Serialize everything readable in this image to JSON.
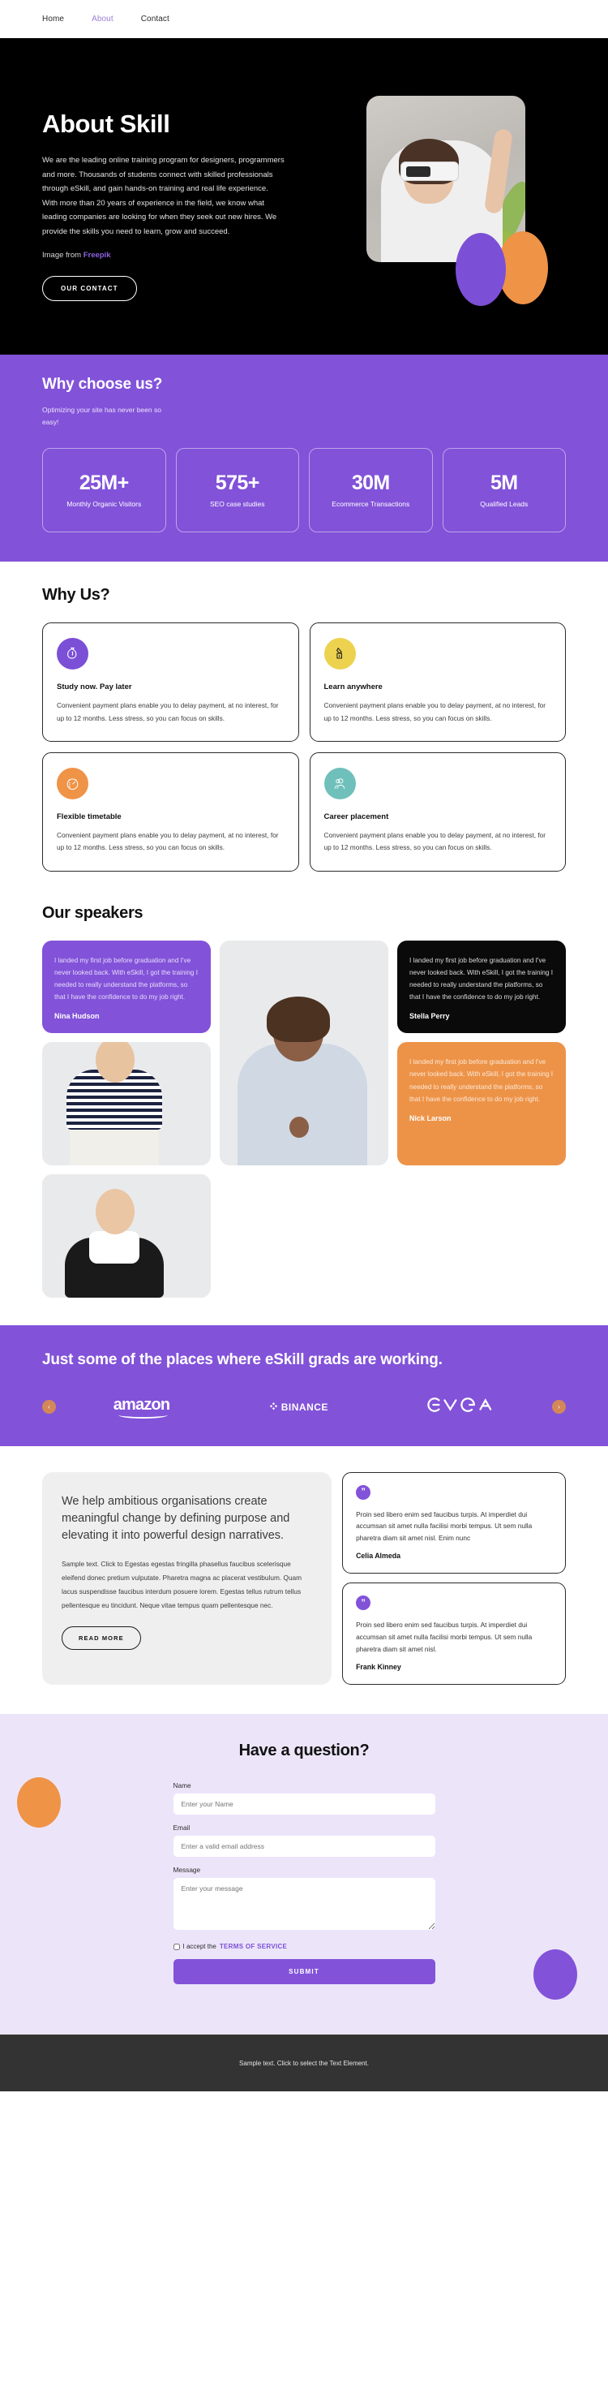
{
  "nav": {
    "items": [
      {
        "label": "Home",
        "active": false
      },
      {
        "label": "About",
        "active": true
      },
      {
        "label": "Contact",
        "active": false
      }
    ]
  },
  "hero": {
    "title": "About Skill",
    "body": "We are the leading online training program for designers, programmers and more. Thousands of students connect with skilled professionals through eSkill, and gain hands-on training and real life experience. With more than 20 years of experience in the field, we know what leading companies are looking for when they seek out new hires. We provide the skills you need to learn, grow and succeed.",
    "credit_prefix": "Image from ",
    "credit_link": "Freepik",
    "cta": "OUR CONTACT",
    "colors": {
      "purple_blob": "#7b4fd6",
      "orange_blob": "#ef9347"
    }
  },
  "stats": {
    "heading": "Why choose us?",
    "subheading": "Optimizing your site has never been so easy!",
    "bg": "#8252d9",
    "cards": [
      {
        "number": "25M+",
        "label": "Monthly Organic Visitors"
      },
      {
        "number": "575+",
        "label": "SEO case studies"
      },
      {
        "number": "30M",
        "label": "Ecommerce Transactions"
      },
      {
        "number": "5M",
        "label": "Qualified Leads"
      }
    ]
  },
  "whyus": {
    "heading": "Why Us?",
    "cards": [
      {
        "icon": "money-bag-icon",
        "icon_bg": "#7b4fd6",
        "icon_glyph": "💰",
        "title": "Study now. Pay later",
        "desc": "Convenient payment plans enable you to delay payment, at no interest, for up to 12 months. Less stress, so you can focus on skills."
      },
      {
        "icon": "hand-coin-icon",
        "icon_bg": "#edd24f",
        "icon_glyph": "✋",
        "title": "Learn anywhere",
        "desc": "Convenient payment plans enable you to delay payment, at no interest, for up to 12 months. Less stress, so you can focus on skills."
      },
      {
        "icon": "stopwatch-icon",
        "icon_bg": "#ef9347",
        "icon_glyph": "⏱",
        "title": "Flexible timetable",
        "desc": "Convenient payment plans enable you to delay payment, at no interest, for up to 12 months. Less stress, so you can focus on skills."
      },
      {
        "icon": "people-icon",
        "icon_bg": "#6fc0bb",
        "icon_glyph": "👥",
        "title": "Career placement",
        "desc": "Convenient payment plans enable you to delay payment, at no interest, for up to 12 months. Less stress, so you can focus on skills."
      }
    ]
  },
  "speakers": {
    "heading": "Our speakers",
    "quote_text": "I landed my first job before graduation and I've never looked back. With eSkill, I got the training I needed to really understand the platforms, so that I have the confidence to do my job right.",
    "items": [
      {
        "name": "Nina Hudson",
        "theme": "purple"
      },
      {
        "name": "Stella Perry",
        "theme": "black"
      },
      {
        "name": "Nick Larson",
        "theme": "orange"
      }
    ]
  },
  "brands": {
    "heading": "Just some of the places where eSkill grads are working.",
    "prev_label": "‹",
    "next_label": "›",
    "logos": [
      {
        "name": "amazon",
        "text": "amazon"
      },
      {
        "name": "binance",
        "text": "BINANCE"
      },
      {
        "name": "evga",
        "text": "ƎνGA"
      }
    ]
  },
  "org": {
    "heading": "We help ambitious organisations create meaningful change by defining purpose and elevating it into powerful design narratives.",
    "body": "Sample text. Click to Egestas egestas fringilla phasellus faucibus scelerisque eleifend donec pretium vulputate. Pharetra magna ac placerat vestibulum. Quam lacus suspendisse faucibus interdum posuere lorem. Egestas tellus rutrum tellus pellentesque eu tincidunt. Neque vitae tempus quam pellentesque nec.",
    "cta": "READ MORE",
    "testimonials": [
      {
        "quote_icon": "quote-icon",
        "text": "Proin sed libero enim sed faucibus turpis. At imperdiet dui accumsan sit amet nulla facilisi morbi tempus. Ut sem nulla pharetra diam sit amet nisl. Enim nunc",
        "name": "Celia Almeda"
      },
      {
        "quote_icon": "quote-icon",
        "text": "Proin sed libero enim sed faucibus turpis. At imperdiet dui accumsan sit amet nulla facilisi morbi tempus. Ut sem nulla pharetra diam sit amet nisl.",
        "name": "Frank Kinney"
      }
    ]
  },
  "form": {
    "heading": "Have a question?",
    "name_label": "Name",
    "name_placeholder": "Enter your Name",
    "name_value": "",
    "email_label": "Email",
    "email_placeholder": "Enter a valid email address",
    "email_value": "",
    "message_label": "Message",
    "message_placeholder": "Enter your message",
    "message_value": "",
    "accept_prefix": "I accept the ",
    "terms_link": "TERMS OF SERVICE",
    "accept_checked": false,
    "submit_label": "SUBMIT",
    "bg": "#ece5fa",
    "accent": "#8252d9"
  },
  "footer": {
    "text": "Sample text. Click to select the Text Element."
  }
}
